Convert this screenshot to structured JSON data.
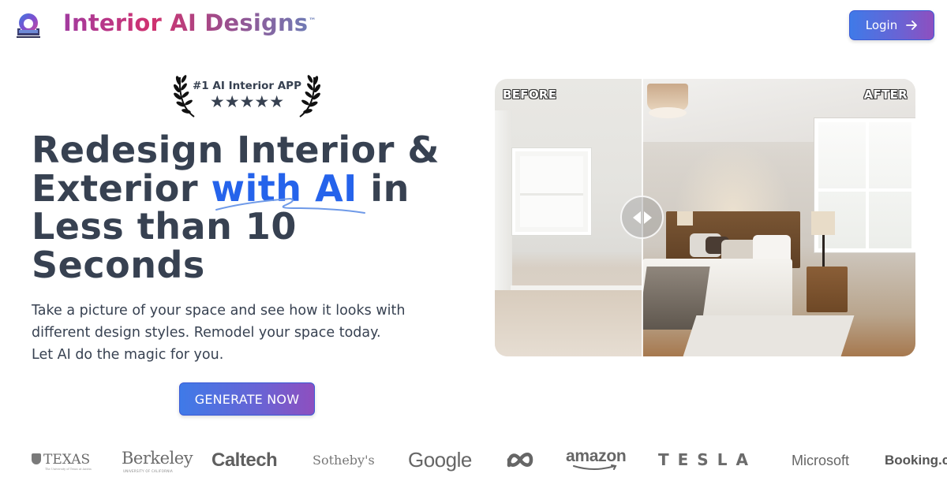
{
  "header": {
    "logo_icon": "armchair-swirl-logo-icon",
    "brand_name": "Interior AI Designs",
    "trademark": "™",
    "login_label": "Login",
    "login_icon": "arrow-right-icon"
  },
  "award": {
    "icon": "laurel-wreath-icon",
    "title": "#1 AI Interior APP",
    "stars": "★★★★★",
    "rating": 5
  },
  "hero": {
    "headline_part1": "Redesign Interior & Exterior ",
    "headline_highlight": "with AI",
    "headline_part2": " in Less than 10 Seconds",
    "subtext_line1": "Take a picture of your space and see how it looks with",
    "subtext_line2": "different design styles. Remodel your space today.",
    "subtext_line3": "Let AI do the magic for you.",
    "cta_label": "GENERATE NOW",
    "accent_color": "#2563eb",
    "text_color": "#374151"
  },
  "comparison": {
    "before_label": "BEFORE",
    "after_label": "AFTER",
    "slider_position": 0.35,
    "handle_icon": "left-right-arrows-icon"
  },
  "logos": [
    {
      "name": "TEXAS",
      "sub": "The University of Texas at Austin"
    },
    {
      "name": "Berkeley",
      "sub": "UNIVERSITY OF CALIFORNIA"
    },
    {
      "name": "Caltech"
    },
    {
      "name": "Sotheby's"
    },
    {
      "name": "Google"
    },
    {
      "name": "Meta"
    },
    {
      "name": "amazon"
    },
    {
      "name": "TESLA"
    },
    {
      "name": "Microsoft"
    },
    {
      "name": "Booking.com"
    }
  ]
}
